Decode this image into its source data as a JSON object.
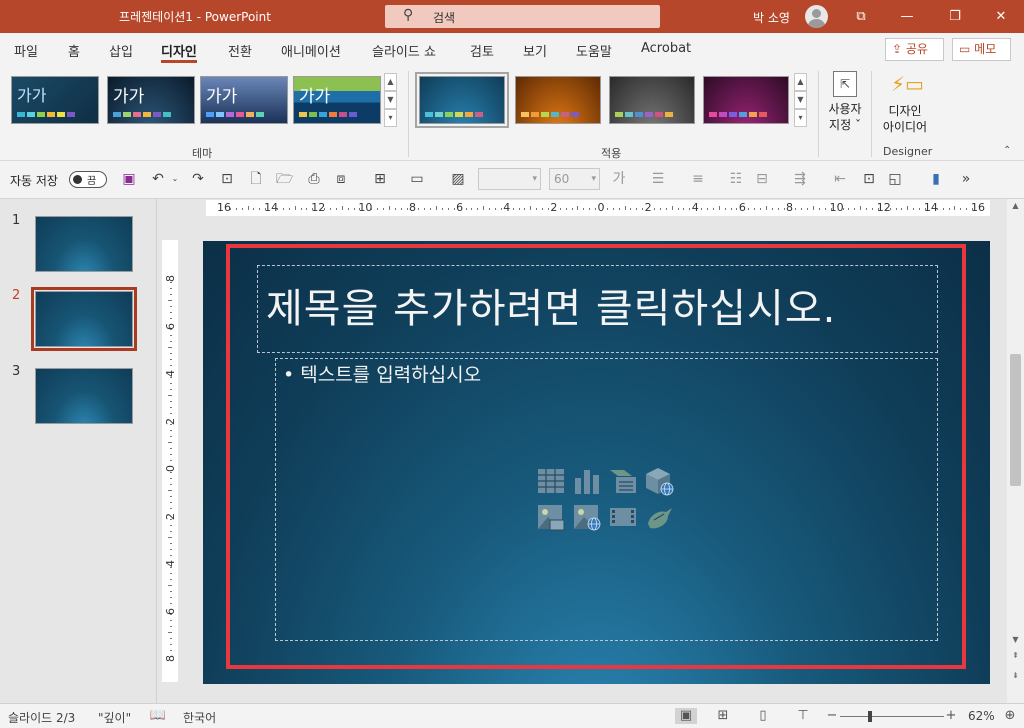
{
  "window": {
    "title": "프레젠테이션1  -  PowerPoint",
    "search_placeholder": "검색",
    "user_name": "박 소영",
    "min_icon": "restore-down-icon",
    "max_glyph": "❐",
    "close_glyph": "✕",
    "ribbon_display_glyph": "⧉",
    "min_glyph": "—"
  },
  "menu": {
    "tabs": [
      "파일",
      "홈",
      "삽입",
      "디자인",
      "전환",
      "애니메이션",
      "슬라이드 쇼",
      "검토",
      "보기",
      "도움말",
      "Acrobat"
    ],
    "active_tab": "디자인",
    "share_label": "공유",
    "comment_label": "메모"
  },
  "ribbon": {
    "themes_group_label": "테마",
    "variants_group_label": "적용",
    "theme_sample_text": "가가",
    "customize_label_1": "사용자",
    "customize_label_2": "지정 ˇ",
    "designer_label_1": "디자인",
    "designer_label_2": "아이디어",
    "designer_group_label": "Designer"
  },
  "qat": {
    "autosave_label": "자동 저장",
    "autosave_state": "끔",
    "font_name": "",
    "font_size": "60",
    "more_glyph": "»"
  },
  "ruler": {
    "h_ticks": [
      "16",
      "14",
      "12",
      "10",
      "8",
      "6",
      "4",
      "2",
      "0",
      "2",
      "4",
      "6",
      "8",
      "10",
      "12",
      "14",
      "16"
    ],
    "v_ticks": [
      "8",
      "6",
      "4",
      "2",
      "0",
      "2",
      "4",
      "6",
      "8"
    ]
  },
  "thumbnails": {
    "items": [
      {
        "num": "1"
      },
      {
        "num": "2"
      },
      {
        "num": "3"
      }
    ],
    "selected": "2"
  },
  "slide": {
    "title_placeholder": "제목을 추가하려면 클릭하십시오.",
    "body_placeholder": "• 텍스트를 입력하십시오"
  },
  "status": {
    "slide_counter": "슬라이드 2/3",
    "theme_name": "\"깊이\"",
    "language": "한국어",
    "zoom": "62%",
    "zoom_fraction": 0.62
  },
  "colors": {
    "accent": "#b7472a",
    "slide_bg": "#0f3d58",
    "highlight_frame": "#e8383d"
  }
}
